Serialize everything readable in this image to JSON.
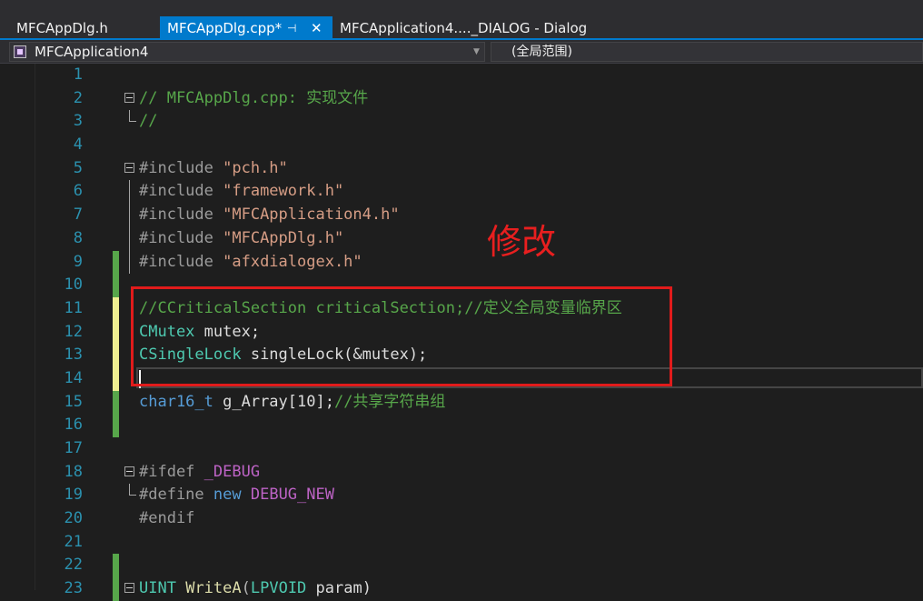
{
  "tabs": [
    {
      "label": "MFCAppDlg.h",
      "active": false
    },
    {
      "label": "MFCAppDlg.cpp*",
      "active": true,
      "pin_icon": "⊣",
      "close_icon": "✕"
    },
    {
      "label": "MFCApplication4...._DIALOG - Dialog",
      "active": false
    }
  ],
  "nav": {
    "project": "MFCApplication4",
    "scope": "(全局范围)"
  },
  "annotation": {
    "label": "修改",
    "color": "#e11b1b"
  },
  "editor": {
    "lines": [
      {
        "n": "1",
        "change": "none",
        "fold": "none",
        "tokens": []
      },
      {
        "n": "2",
        "change": "none",
        "fold": "open",
        "tokens": [
          {
            "t": "// MFCAppDlg.cpp: 实现文件",
            "c": "comment"
          }
        ]
      },
      {
        "n": "3",
        "change": "none",
        "fold": "end",
        "tokens": [
          {
            "t": "//",
            "c": "comment"
          }
        ]
      },
      {
        "n": "4",
        "change": "none",
        "fold": "none",
        "tokens": []
      },
      {
        "n": "5",
        "change": "none",
        "fold": "open",
        "tokens": [
          {
            "t": "#include ",
            "c": "pre"
          },
          {
            "t": "\"pch.h\"",
            "c": "str"
          }
        ]
      },
      {
        "n": "6",
        "change": "none",
        "fold": "guide",
        "tokens": [
          {
            "t": "#include ",
            "c": "pre"
          },
          {
            "t": "\"framework.h\"",
            "c": "str"
          }
        ]
      },
      {
        "n": "7",
        "change": "none",
        "fold": "guide",
        "tokens": [
          {
            "t": "#include ",
            "c": "pre"
          },
          {
            "t": "\"MFCApplication4.h\"",
            "c": "str"
          }
        ]
      },
      {
        "n": "8",
        "change": "none",
        "fold": "guide",
        "tokens": [
          {
            "t": "#include ",
            "c": "pre"
          },
          {
            "t": "\"MFCAppDlg.h\"",
            "c": "str"
          }
        ]
      },
      {
        "n": "9",
        "change": "saved",
        "fold": "guide",
        "tokens": [
          {
            "t": "#include ",
            "c": "pre"
          },
          {
            "t": "\"afxdialogex.h\"",
            "c": "str"
          }
        ]
      },
      {
        "n": "10",
        "change": "saved",
        "fold": "none",
        "tokens": []
      },
      {
        "n": "11",
        "change": "unsaved",
        "fold": "none",
        "tokens": [
          {
            "t": "//CCriticalSection criticalSection;//定义全局变量临界区",
            "c": "comment"
          }
        ]
      },
      {
        "n": "12",
        "change": "unsaved",
        "fold": "none",
        "tokens": [
          {
            "t": "CMutex",
            "c": "type"
          },
          {
            "t": " mutex;",
            "c": "plain"
          }
        ]
      },
      {
        "n": "13",
        "change": "unsaved",
        "fold": "none",
        "tokens": [
          {
            "t": "CSingleLock",
            "c": "type"
          },
          {
            "t": " singleLock(&mutex);",
            "c": "plain"
          }
        ]
      },
      {
        "n": "14",
        "change": "unsaved",
        "fold": "none",
        "current": true,
        "tokens": []
      },
      {
        "n": "15",
        "change": "saved",
        "fold": "none",
        "tokens": [
          {
            "t": "char16_t",
            "c": "kw"
          },
          {
            "t": " g_Array[10];",
            "c": "plain"
          },
          {
            "t": "//共享字符串组",
            "c": "comment"
          }
        ]
      },
      {
        "n": "16",
        "change": "saved",
        "fold": "none",
        "tokens": []
      },
      {
        "n": "17",
        "change": "none",
        "fold": "none",
        "tokens": []
      },
      {
        "n": "18",
        "change": "none",
        "fold": "open",
        "tokens": [
          {
            "t": "#ifdef ",
            "c": "pre"
          },
          {
            "t": "_DEBUG",
            "c": "macro"
          }
        ]
      },
      {
        "n": "19",
        "change": "none",
        "fold": "end",
        "tokens": [
          {
            "t": "#define ",
            "c": "pre"
          },
          {
            "t": "new",
            "c": "kw"
          },
          {
            "t": " ",
            "c": "plain"
          },
          {
            "t": "DEBUG_NEW",
            "c": "macro"
          }
        ]
      },
      {
        "n": "20",
        "change": "none",
        "fold": "none",
        "tokens": [
          {
            "t": "#endif",
            "c": "pre"
          }
        ]
      },
      {
        "n": "21",
        "change": "none",
        "fold": "none",
        "tokens": []
      },
      {
        "n": "22",
        "change": "saved",
        "fold": "none",
        "tokens": []
      },
      {
        "n": "23",
        "change": "saved",
        "fold": "open",
        "tokens": [
          {
            "t": "UINT",
            "c": "type"
          },
          {
            "t": " ",
            "c": "plain"
          },
          {
            "t": "WriteA",
            "c": "fn"
          },
          {
            "t": "(",
            "c": "punc"
          },
          {
            "t": "LPVOID",
            "c": "type"
          },
          {
            "t": " param)",
            "c": "plain"
          }
        ]
      }
    ]
  }
}
